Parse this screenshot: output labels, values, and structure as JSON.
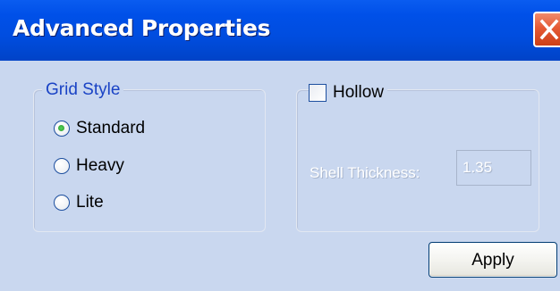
{
  "window": {
    "title": "Advanced Properties"
  },
  "grid_style": {
    "legend": "Grid Style",
    "options": [
      {
        "label": "Standard",
        "checked": true
      },
      {
        "label": "Heavy",
        "checked": false
      },
      {
        "label": "Lite",
        "checked": false
      }
    ]
  },
  "hollow": {
    "label": "Hollow",
    "checked": false,
    "shell_thickness_label": "Shell Thickness:",
    "shell_thickness_value": "1.35",
    "enabled": false
  },
  "buttons": {
    "apply": "Apply"
  },
  "colors": {
    "titlebar": "#0050e8",
    "client": "#c9d7ef",
    "close": "#e55a34",
    "legend_text": "#1a43c5"
  }
}
